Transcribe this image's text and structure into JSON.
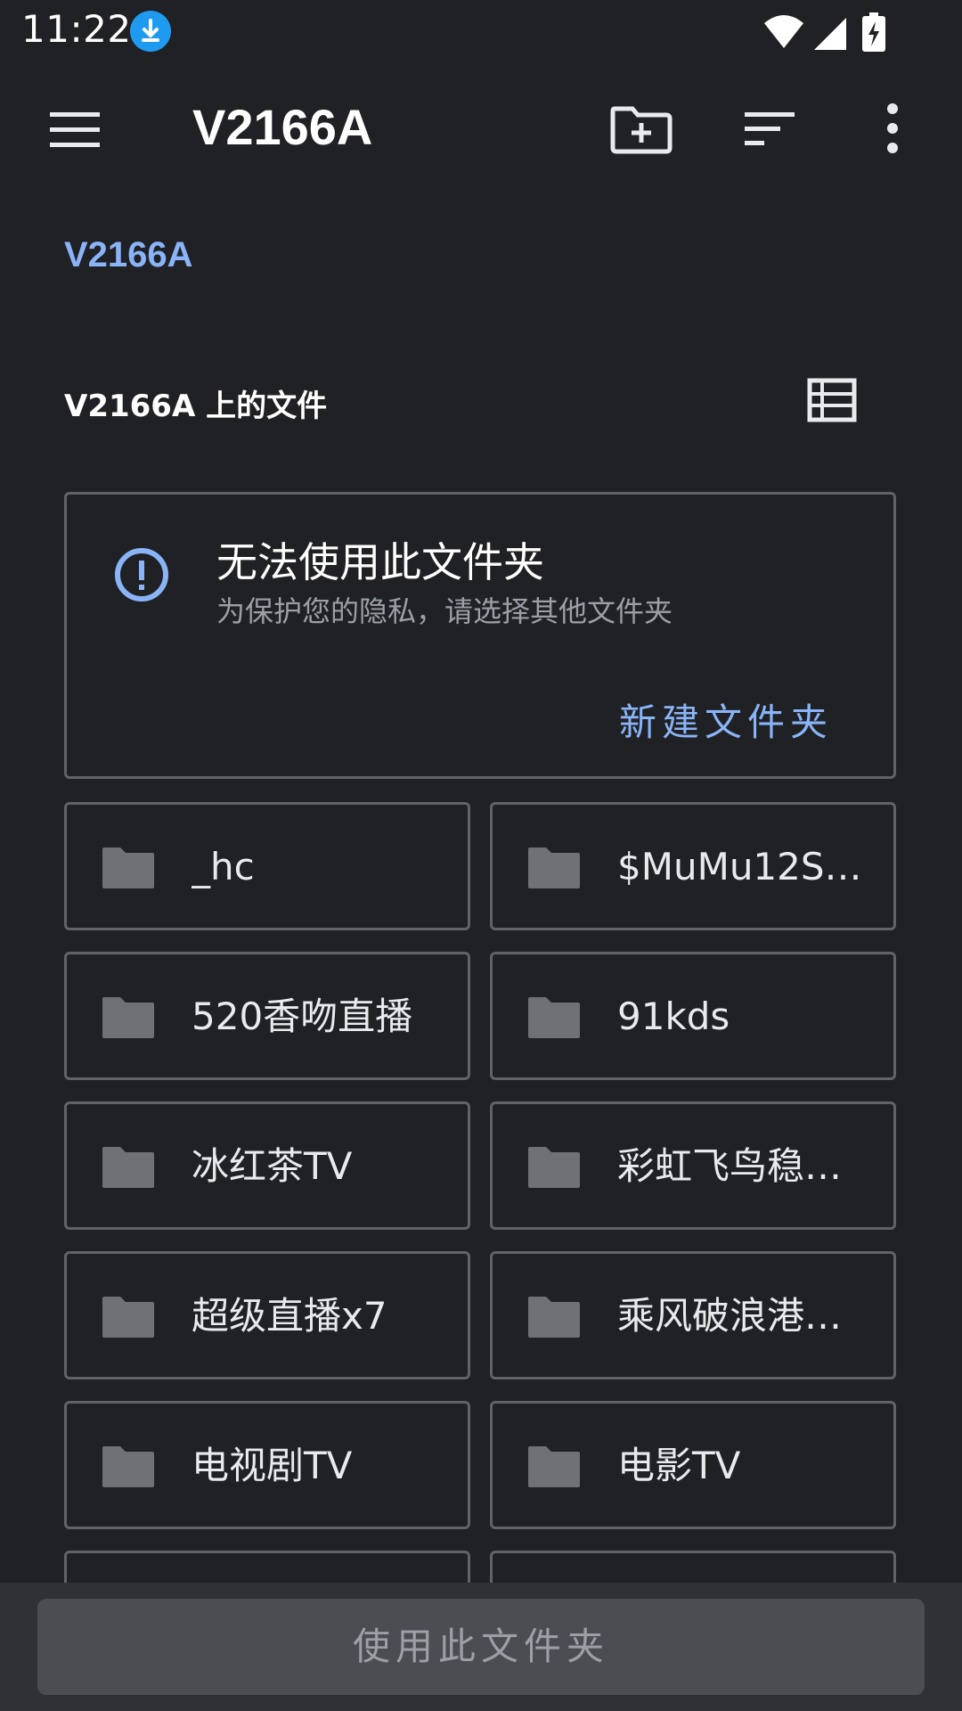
{
  "status_bar": {
    "time": "11:22"
  },
  "app_bar": {
    "title": "V2166A"
  },
  "breadcrumb": {
    "path": "V2166A"
  },
  "section": {
    "title": "V2166A 上的文件"
  },
  "warning": {
    "title": "无法使用此文件夹",
    "subtitle": "为保护您的隐私，请选择其他文件夹",
    "action_label": "新建文件夹"
  },
  "folders": [
    {
      "name": "_hc"
    },
    {
      "name": "$MuMu12Sh…"
    },
    {
      "name": "520香吻直播"
    },
    {
      "name": "91kds"
    },
    {
      "name": "冰红茶TV"
    },
    {
      "name": "彩虹飞鸟稳…"
    },
    {
      "name": "超级直播x7"
    },
    {
      "name": "乘风破浪港…"
    },
    {
      "name": "电视剧TV"
    },
    {
      "name": "电影TV"
    },
    {
      "name": ""
    },
    {
      "name": ""
    }
  ],
  "bottom": {
    "use_folder_label": "使用此文件夹"
  },
  "colors": {
    "background": "#202124",
    "accent": "#8ab4f8",
    "border": "#5f6368",
    "folder_icon": "#6f7174"
  }
}
